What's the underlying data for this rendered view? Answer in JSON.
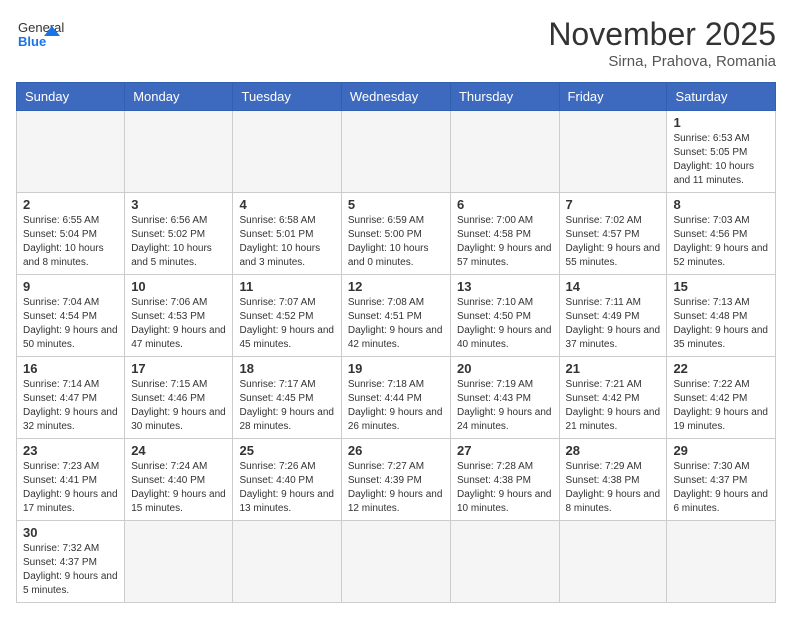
{
  "header": {
    "logo_general": "General",
    "logo_blue": "Blue",
    "month_year": "November 2025",
    "location": "Sirna, Prahova, Romania"
  },
  "weekdays": [
    "Sunday",
    "Monday",
    "Tuesday",
    "Wednesday",
    "Thursday",
    "Friday",
    "Saturday"
  ],
  "weeks": [
    [
      {
        "day": "",
        "info": ""
      },
      {
        "day": "",
        "info": ""
      },
      {
        "day": "",
        "info": ""
      },
      {
        "day": "",
        "info": ""
      },
      {
        "day": "",
        "info": ""
      },
      {
        "day": "",
        "info": ""
      },
      {
        "day": "1",
        "info": "Sunrise: 6:53 AM\nSunset: 5:05 PM\nDaylight: 10 hours and 11 minutes."
      }
    ],
    [
      {
        "day": "2",
        "info": "Sunrise: 6:55 AM\nSunset: 5:04 PM\nDaylight: 10 hours and 8 minutes."
      },
      {
        "day": "3",
        "info": "Sunrise: 6:56 AM\nSunset: 5:02 PM\nDaylight: 10 hours and 5 minutes."
      },
      {
        "day": "4",
        "info": "Sunrise: 6:58 AM\nSunset: 5:01 PM\nDaylight: 10 hours and 3 minutes."
      },
      {
        "day": "5",
        "info": "Sunrise: 6:59 AM\nSunset: 5:00 PM\nDaylight: 10 hours and 0 minutes."
      },
      {
        "day": "6",
        "info": "Sunrise: 7:00 AM\nSunset: 4:58 PM\nDaylight: 9 hours and 57 minutes."
      },
      {
        "day": "7",
        "info": "Sunrise: 7:02 AM\nSunset: 4:57 PM\nDaylight: 9 hours and 55 minutes."
      },
      {
        "day": "8",
        "info": "Sunrise: 7:03 AM\nSunset: 4:56 PM\nDaylight: 9 hours and 52 minutes."
      }
    ],
    [
      {
        "day": "9",
        "info": "Sunrise: 7:04 AM\nSunset: 4:54 PM\nDaylight: 9 hours and 50 minutes."
      },
      {
        "day": "10",
        "info": "Sunrise: 7:06 AM\nSunset: 4:53 PM\nDaylight: 9 hours and 47 minutes."
      },
      {
        "day": "11",
        "info": "Sunrise: 7:07 AM\nSunset: 4:52 PM\nDaylight: 9 hours and 45 minutes."
      },
      {
        "day": "12",
        "info": "Sunrise: 7:08 AM\nSunset: 4:51 PM\nDaylight: 9 hours and 42 minutes."
      },
      {
        "day": "13",
        "info": "Sunrise: 7:10 AM\nSunset: 4:50 PM\nDaylight: 9 hours and 40 minutes."
      },
      {
        "day": "14",
        "info": "Sunrise: 7:11 AM\nSunset: 4:49 PM\nDaylight: 9 hours and 37 minutes."
      },
      {
        "day": "15",
        "info": "Sunrise: 7:13 AM\nSunset: 4:48 PM\nDaylight: 9 hours and 35 minutes."
      }
    ],
    [
      {
        "day": "16",
        "info": "Sunrise: 7:14 AM\nSunset: 4:47 PM\nDaylight: 9 hours and 32 minutes."
      },
      {
        "day": "17",
        "info": "Sunrise: 7:15 AM\nSunset: 4:46 PM\nDaylight: 9 hours and 30 minutes."
      },
      {
        "day": "18",
        "info": "Sunrise: 7:17 AM\nSunset: 4:45 PM\nDaylight: 9 hours and 28 minutes."
      },
      {
        "day": "19",
        "info": "Sunrise: 7:18 AM\nSunset: 4:44 PM\nDaylight: 9 hours and 26 minutes."
      },
      {
        "day": "20",
        "info": "Sunrise: 7:19 AM\nSunset: 4:43 PM\nDaylight: 9 hours and 24 minutes."
      },
      {
        "day": "21",
        "info": "Sunrise: 7:21 AM\nSunset: 4:42 PM\nDaylight: 9 hours and 21 minutes."
      },
      {
        "day": "22",
        "info": "Sunrise: 7:22 AM\nSunset: 4:42 PM\nDaylight: 9 hours and 19 minutes."
      }
    ],
    [
      {
        "day": "23",
        "info": "Sunrise: 7:23 AM\nSunset: 4:41 PM\nDaylight: 9 hours and 17 minutes."
      },
      {
        "day": "24",
        "info": "Sunrise: 7:24 AM\nSunset: 4:40 PM\nDaylight: 9 hours and 15 minutes."
      },
      {
        "day": "25",
        "info": "Sunrise: 7:26 AM\nSunset: 4:40 PM\nDaylight: 9 hours and 13 minutes."
      },
      {
        "day": "26",
        "info": "Sunrise: 7:27 AM\nSunset: 4:39 PM\nDaylight: 9 hours and 12 minutes."
      },
      {
        "day": "27",
        "info": "Sunrise: 7:28 AM\nSunset: 4:38 PM\nDaylight: 9 hours and 10 minutes."
      },
      {
        "day": "28",
        "info": "Sunrise: 7:29 AM\nSunset: 4:38 PM\nDaylight: 9 hours and 8 minutes."
      },
      {
        "day": "29",
        "info": "Sunrise: 7:30 AM\nSunset: 4:37 PM\nDaylight: 9 hours and 6 minutes."
      }
    ],
    [
      {
        "day": "30",
        "info": "Sunrise: 7:32 AM\nSunset: 4:37 PM\nDaylight: 9 hours and 5 minutes."
      },
      {
        "day": "",
        "info": ""
      },
      {
        "day": "",
        "info": ""
      },
      {
        "day": "",
        "info": ""
      },
      {
        "day": "",
        "info": ""
      },
      {
        "day": "",
        "info": ""
      },
      {
        "day": "",
        "info": ""
      }
    ]
  ]
}
